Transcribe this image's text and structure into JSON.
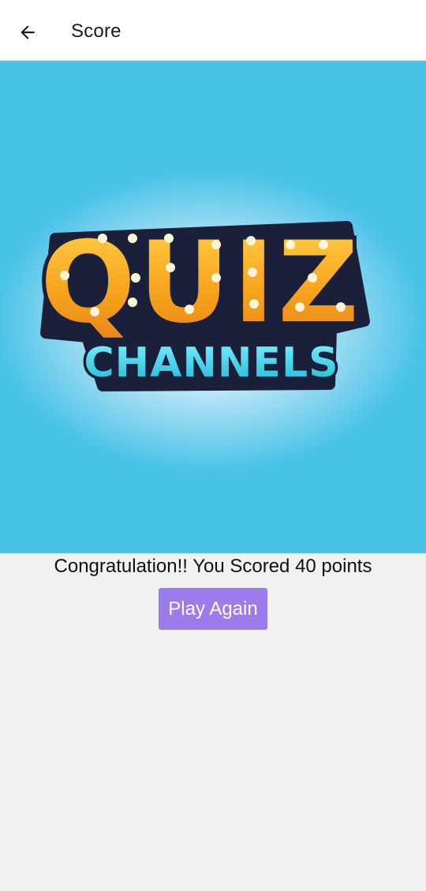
{
  "app_bar": {
    "title": "Score",
    "back_icon": "arrow-left-icon"
  },
  "banner": {
    "logo_text_top": "QUIZ",
    "logo_text_bottom": "CHANNELS",
    "colors": {
      "background": "#4ac3e8",
      "letters_top": "#f7a51d",
      "letters_bottom": "#35d2ea",
      "outline": "#1a1f3a"
    }
  },
  "result": {
    "message": "Congratulation!! You Scored 40 points"
  },
  "actions": {
    "play_again_label": "Play Again",
    "accent": "#9c7cea"
  }
}
